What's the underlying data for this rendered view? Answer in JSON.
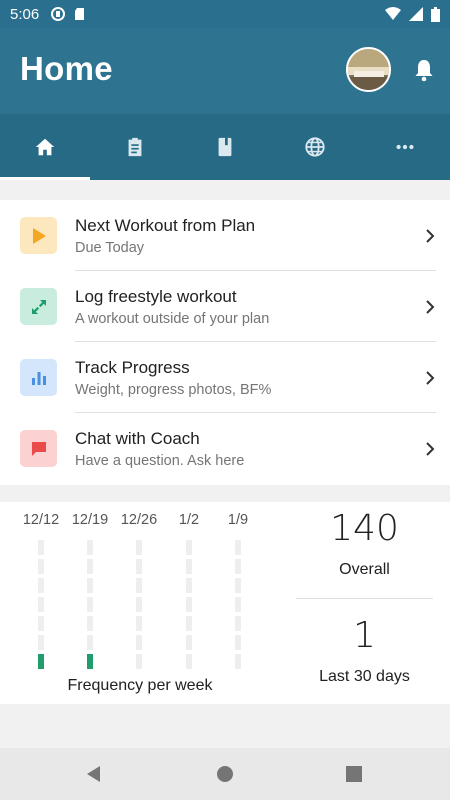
{
  "status_bar": {
    "time": "5:06"
  },
  "header": {
    "title": "Home"
  },
  "tabs": [
    {
      "icon": "home-icon"
    },
    {
      "icon": "clipboard-icon"
    },
    {
      "icon": "book-icon"
    },
    {
      "icon": "globe-icon"
    },
    {
      "icon": "more-icon"
    }
  ],
  "menu": [
    {
      "title": "Next Workout from Plan",
      "subtitle": "Due Today",
      "icon": "play-icon",
      "bg": "#fde7bf",
      "fg": "#f5a623"
    },
    {
      "title": "Log freestyle workout",
      "subtitle": "A workout outside of your plan",
      "icon": "expand-arrows-icon",
      "bg": "#c8ecdd",
      "fg": "#1f9e6b"
    },
    {
      "title": "Track Progress",
      "subtitle": "Weight, progress photos, BF%",
      "icon": "bar-chart-icon",
      "bg": "#d3e6fb",
      "fg": "#4a90e2"
    },
    {
      "title": "Chat with Coach",
      "subtitle": "Have a question. Ask here",
      "icon": "chat-icon",
      "bg": "#fbd1d1",
      "fg": "#e94b4b"
    }
  ],
  "frequency": {
    "label": "Frequency per week",
    "weeks": [
      "12/12",
      "12/19",
      "12/26",
      "1/2",
      "1/9"
    ],
    "counts": [
      1,
      1,
      0,
      0,
      0
    ],
    "max": 7
  },
  "stats": {
    "overall_value": "140",
    "overall_label": "Overall",
    "last30_value": "1",
    "last30_label": "Last 30 days"
  },
  "colors": {
    "header": "#2e7491",
    "tabbar": "#276a86",
    "fill": "#1f9e6b"
  }
}
